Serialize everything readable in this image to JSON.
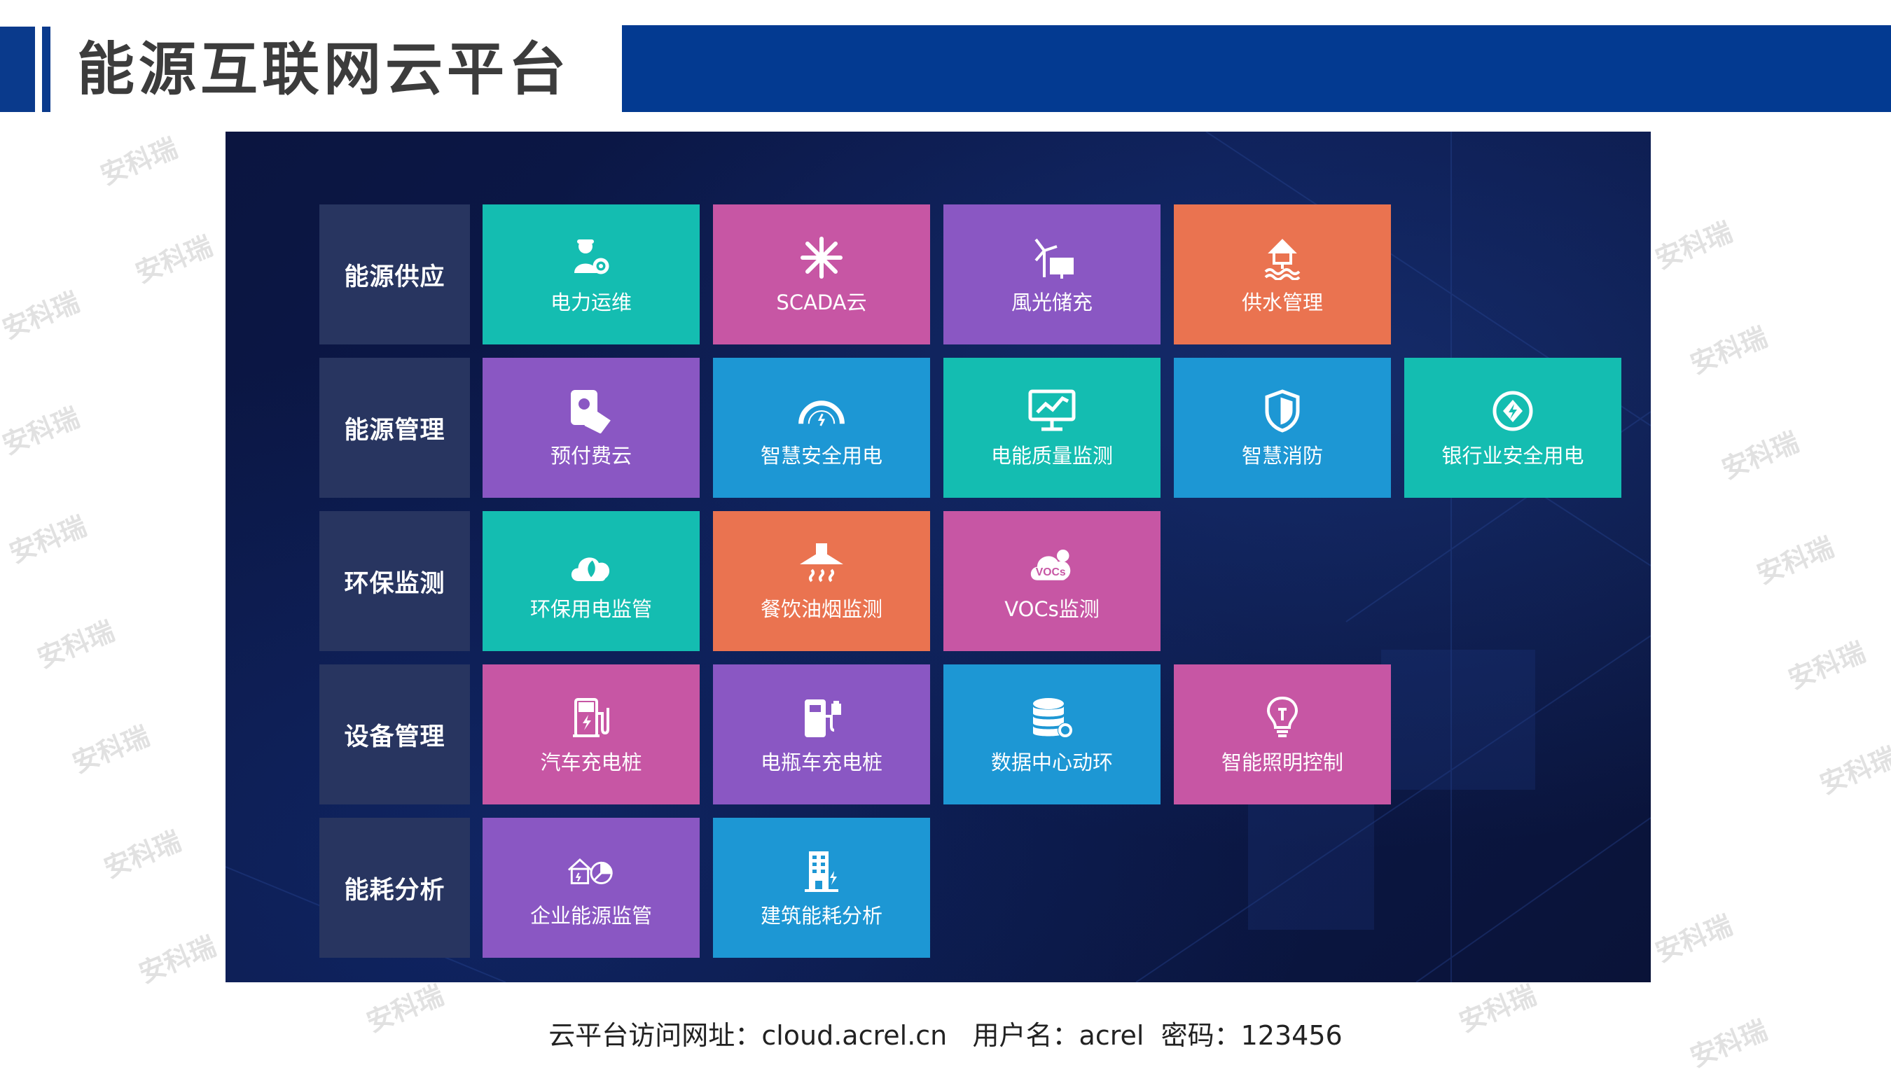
{
  "header": {
    "title": "能源互联网云平台"
  },
  "watermark": "安科瑞",
  "categories": [
    {
      "label": "能源供应"
    },
    {
      "label": "能源管理"
    },
    {
      "label": "环保监测"
    },
    {
      "label": "设备管理"
    },
    {
      "label": "能耗分析"
    }
  ],
  "tiles": {
    "power_om": {
      "label": "电力运维",
      "icon": "worker-gear-icon",
      "color": "#14bdb1"
    },
    "scada": {
      "label": "SCADA云",
      "icon": "snowflake-icon",
      "color": "#c756a4"
    },
    "wind_solar": {
      "label": "風光储充",
      "icon": "wind-solar-icon",
      "color": "#8a57c3"
    },
    "water": {
      "label": "供水管理",
      "icon": "water-tower-icon",
      "color": "#ea7350"
    },
    "prepaid": {
      "label": "预付费云",
      "icon": "prepaid-card-icon",
      "color": "#8a57c3"
    },
    "smart_safety": {
      "label": "智慧安全用电",
      "icon": "gauge-icon",
      "color": "#1d97d4"
    },
    "power_quality": {
      "label": "电能质量监测",
      "icon": "monitor-chart-icon",
      "color": "#14bdb1"
    },
    "fire": {
      "label": "智慧消防",
      "icon": "shield-icon",
      "color": "#1d97d4"
    },
    "bank": {
      "label": "银行业安全用电",
      "icon": "lightning-circle-icon",
      "color": "#14bdb1"
    },
    "env_power": {
      "label": "环保用电监管",
      "icon": "cloud-leaf-icon",
      "color": "#14bdb1"
    },
    "fume": {
      "label": "餐饮油烟监测",
      "icon": "range-hood-icon",
      "color": "#ea7350"
    },
    "vocs": {
      "label": "VOCs监测",
      "icon": "vocs-cloud-icon",
      "color": "#c756a4"
    },
    "ev_charger": {
      "label": "汽车充电桩",
      "icon": "ev-charger-icon",
      "color": "#c756a4"
    },
    "ebike_charger": {
      "label": "电瓶车充电桩",
      "icon": "ebike-charger-icon",
      "color": "#8a57c3"
    },
    "datacenter": {
      "label": "数据中心动环",
      "icon": "database-icon",
      "color": "#1d97d4"
    },
    "lighting": {
      "label": "智能照明控制",
      "icon": "lightbulb-icon",
      "color": "#c756a4"
    },
    "enterprise": {
      "label": "企业能源监管",
      "icon": "house-pie-icon",
      "color": "#8a57c3"
    },
    "building": {
      "label": "建筑能耗分析",
      "icon": "building-icon",
      "color": "#1d97d4"
    }
  },
  "footer": {
    "url_label": "云平台访问网址：",
    "url": "cloud.acrel.cn",
    "user_label": "用户名：",
    "user": "acrel",
    "pwd_label": "密码：",
    "pwd": "123456"
  }
}
